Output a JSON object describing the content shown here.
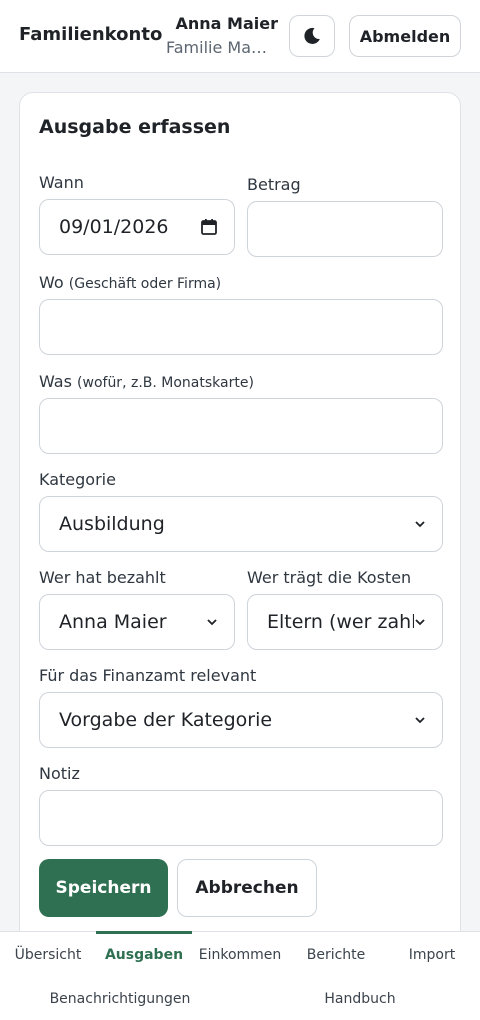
{
  "header": {
    "brand": "Familienkonto",
    "user_name": "Anna Maier",
    "user_family": "Familie Maier",
    "theme_icon": "moon-icon",
    "logout_label": "Abmelden"
  },
  "form": {
    "title": "Ausgabe erfassen",
    "when": {
      "label": "Wann",
      "value": "09/01/2026"
    },
    "amount": {
      "label": "Betrag",
      "value": ""
    },
    "where": {
      "label": "Wo",
      "hint": "(Geschäft oder Firma)",
      "value": ""
    },
    "what": {
      "label": "Was",
      "hint": "(wofür, z.B. Monatskarte)",
      "value": ""
    },
    "category": {
      "label": "Kategorie",
      "value": "Ausbildung"
    },
    "payer": {
      "label": "Wer hat bezahlt",
      "value": "Anna Maier"
    },
    "bearer": {
      "label": "Wer trägt die Kosten",
      "value": "Eltern (wer zahlt)"
    },
    "tax": {
      "label": "Für das Finanzamt relevant",
      "value": "Vorgabe der Kategorie"
    },
    "note": {
      "label": "Notiz",
      "value": ""
    },
    "save_label": "Speichern",
    "cancel_label": "Abbrechen"
  },
  "nav": {
    "items": [
      "Übersicht",
      "Ausgaben",
      "Einkommen",
      "Berichte",
      "Import",
      "Benachrichtigungen",
      "Handbuch"
    ],
    "active": "Ausgaben"
  },
  "colors": {
    "accent": "#2e7051",
    "border": "#cfd4da",
    "background": "#f4f5f7"
  }
}
